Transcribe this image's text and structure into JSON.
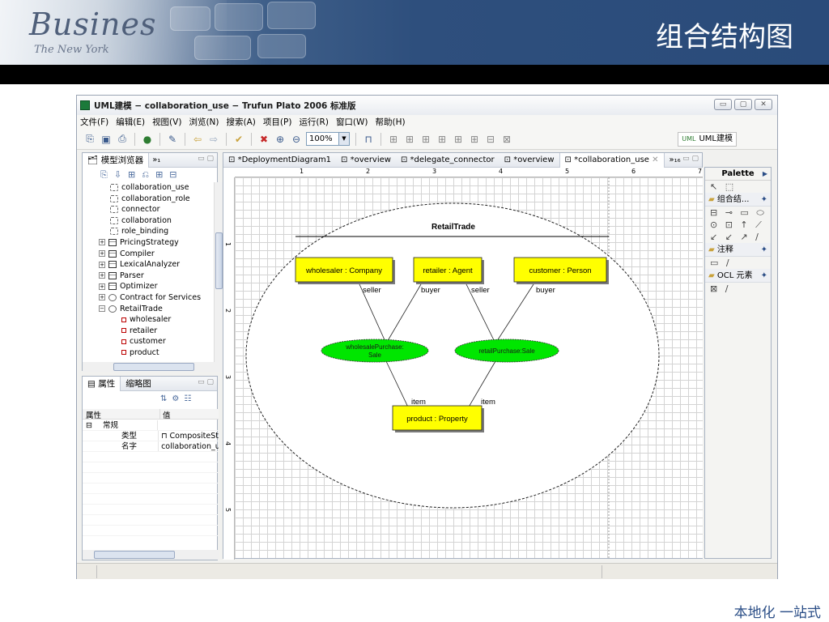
{
  "slide": {
    "title": "组合结构图",
    "footer": "本地化 一站式",
    "banner_logo": "Busines",
    "banner_sub": "The New York"
  },
  "window": {
    "title": "UML建模 − collaboration_use − Trufun Plato 2006 标准版"
  },
  "menu": [
    "文件(F)",
    "编辑(E)",
    "视图(V)",
    "浏览(N)",
    "搜索(A)",
    "项目(P)",
    "运行(R)",
    "窗口(W)",
    "帮助(H)"
  ],
  "toolbar": {
    "zoom_value": "100%",
    "perspective": "UML建模"
  },
  "model_browser": {
    "tab": "模型浏览器",
    "overflow": "»₁",
    "items": [
      {
        "label": "collaboration_use",
        "icon": "collaboration-icon",
        "level": 3
      },
      {
        "label": "collaboration_role",
        "icon": "collaboration-icon",
        "level": 3
      },
      {
        "label": "connector",
        "icon": "collaboration-icon",
        "level": 3
      },
      {
        "label": "collaboration",
        "icon": "collaboration-icon",
        "level": 3
      },
      {
        "label": "role_binding",
        "icon": "collaboration-icon",
        "level": 3
      },
      {
        "label": "PricingStrategy",
        "icon": "class-icon",
        "level": 1,
        "exp": "+"
      },
      {
        "label": "Compiler",
        "icon": "class-icon",
        "level": 1,
        "exp": "+"
      },
      {
        "label": "LexicalAnalyzer",
        "icon": "class-icon",
        "level": 1,
        "exp": "+"
      },
      {
        "label": "Parser",
        "icon": "class-icon",
        "level": 1,
        "exp": "+"
      },
      {
        "label": "Optimizer",
        "icon": "class-icon",
        "level": 1,
        "exp": "+"
      },
      {
        "label": "Contract for Services",
        "icon": "usecase-icon",
        "level": 1,
        "exp": "+"
      },
      {
        "label": "RetailTrade",
        "icon": "usecase-icon",
        "level": 1,
        "exp": "−"
      },
      {
        "label": "wholesaler",
        "icon": "property-icon",
        "level": 2
      },
      {
        "label": "retailer",
        "icon": "property-icon",
        "level": 2
      },
      {
        "label": "customer",
        "icon": "property-icon",
        "level": 2
      },
      {
        "label": "product",
        "icon": "property-icon",
        "level": 2
      }
    ]
  },
  "properties": {
    "tab": "属性",
    "tab2": "缩略图",
    "col_name": "属性",
    "col_value": "值",
    "group": "常规",
    "rows": [
      {
        "name": "类型",
        "value": "CompositeStru"
      },
      {
        "name": "名字",
        "value": "collaboration_use"
      }
    ]
  },
  "editor": {
    "tabs": [
      "*DeploymentDiagram1",
      "*overview",
      "*delegate_connector",
      "*overview",
      "*collaboration_use"
    ],
    "overflow": "»₁₆",
    "ruler_h": [
      "1",
      "2",
      "3",
      "4",
      "5",
      "6",
      "7"
    ],
    "ruler_v": [
      "1",
      "2",
      "3",
      "4",
      "5"
    ]
  },
  "diagram": {
    "collaboration_name": "RetailTrade",
    "parts": [
      "wholesaler : Company",
      "retailer : Agent",
      "customer : Person",
      "product : Property"
    ],
    "usecases": [
      "wholesalePurchase:\nSale",
      "retailPurchase:Sale"
    ],
    "role_labels": [
      "seller",
      "buyer",
      "seller",
      "buyer",
      "item",
      "item"
    ],
    "colors": {
      "part_fill": "#ffff00",
      "usecase_fill": "#00ff00"
    }
  },
  "palette": {
    "title": "Palette",
    "groups": [
      "组合结...",
      "注释",
      "OCL 元素"
    ]
  }
}
